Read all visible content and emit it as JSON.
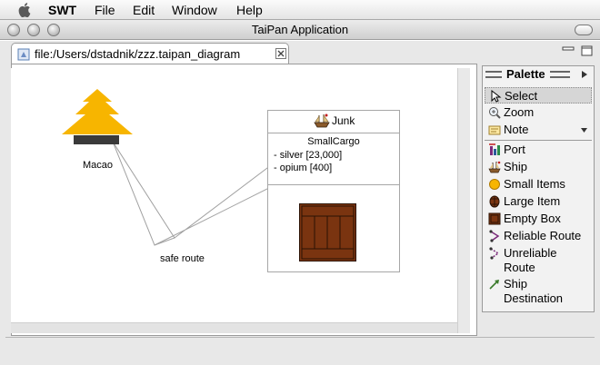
{
  "menubar": {
    "app_name": "SWT",
    "items": [
      "File",
      "Edit",
      "Window",
      "Help"
    ]
  },
  "window": {
    "title": "TaiPan Application"
  },
  "editor": {
    "tab_label": "file:/Users/dstadnik/zzz.taipan_diagram",
    "tab_icon": "diagram-file-icon",
    "close_icon": "close-icon"
  },
  "diagram": {
    "port": {
      "name": "Macao",
      "icon": "pagoda-icon",
      "color": "#f7b500"
    },
    "route": {
      "label": "safe route"
    },
    "ship": {
      "name": "Junk",
      "compartment_title": "SmallCargo",
      "cargo": [
        "- silver [23,000]",
        "- opium [400]"
      ],
      "box_color": "#7a3410"
    }
  },
  "palette": {
    "title": "Palette",
    "tools": [
      {
        "label": "Select",
        "icon": "arrow-cursor-icon",
        "selected": true
      },
      {
        "label": "Zoom",
        "icon": "magnifier-icon"
      },
      {
        "label": "Note",
        "icon": "note-icon",
        "has_dropdown": true
      }
    ],
    "items": [
      {
        "label": "Port",
        "icon": "port-icon"
      },
      {
        "label": "Ship",
        "icon": "ship-icon"
      },
      {
        "label": "Small Items",
        "icon": "small-items-icon"
      },
      {
        "label": "Large Item",
        "icon": "barrel-icon"
      },
      {
        "label": "Empty Box",
        "icon": "box-icon"
      },
      {
        "label": "Reliable Route",
        "icon": "route-icon"
      },
      {
        "label": "Unreliable Route",
        "label_line2": "",
        "icon": "route-icon"
      },
      {
        "label": "Ship Destination",
        "icon": "destination-arrow-icon"
      }
    ]
  }
}
